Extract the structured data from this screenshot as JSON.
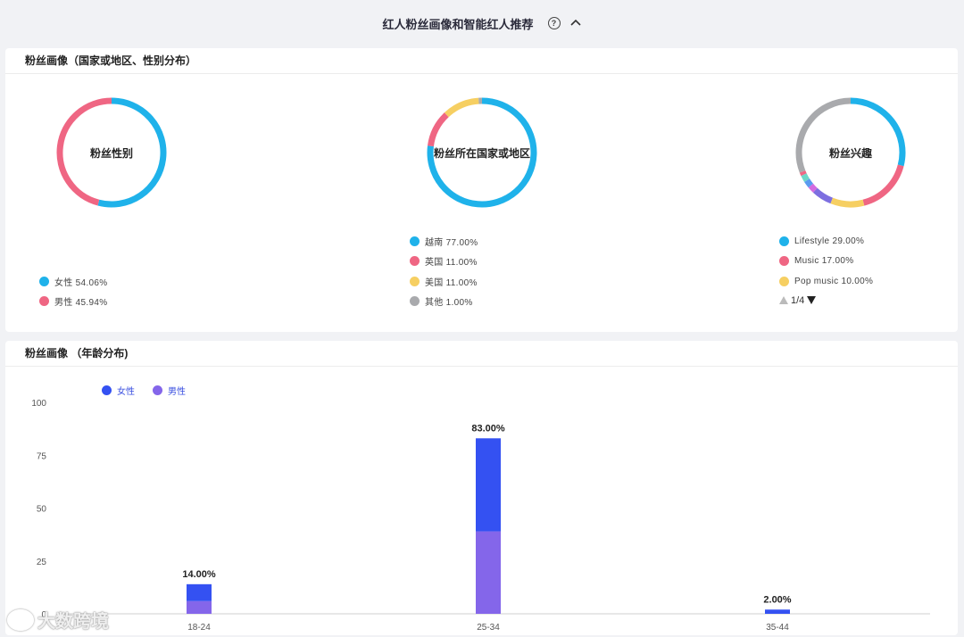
{
  "header": {
    "title": "红人粉丝画像和智能红人推荐",
    "help_glyph": "?",
    "collapse_icon": "chevron-up-icon"
  },
  "profile_card": {
    "title": "粉丝画像（国家或地区、性别分布）",
    "gender": {
      "center_label": "粉丝性别",
      "items": [
        {
          "label": "女性 54.06%",
          "value": 54.06,
          "color": "#1fb2ea"
        },
        {
          "label": "男性 45.94%",
          "value": 45.94,
          "color": "#ef6683"
        }
      ]
    },
    "country": {
      "center_label": "粉丝所在国家或地区",
      "items": [
        {
          "label": "越南 77.00%",
          "value": 77,
          "color": "#1fb2ea"
        },
        {
          "label": "英国 11.00%",
          "value": 11,
          "color": "#ef6683"
        },
        {
          "label": "美国 11.00%",
          "value": 11,
          "color": "#f6cf62"
        },
        {
          "label": "其他 1.00%",
          "value": 1,
          "color": "#a9aaad"
        }
      ]
    },
    "interest": {
      "center_label": "粉丝兴趣",
      "items": [
        {
          "label": "Lifestyle 29.00%",
          "value": 29,
          "color": "#1fb2ea"
        },
        {
          "label": "Music 17.00%",
          "value": 17,
          "color": "#ef6683"
        },
        {
          "label": "Pop music 10.00%",
          "value": 10,
          "color": "#f6cf62"
        }
      ],
      "other_segments": [
        {
          "value": 6,
          "color": "#7d6fe0"
        },
        {
          "value": 2,
          "color": "#d36be0"
        },
        {
          "value": 2,
          "color": "#5a9bf0"
        },
        {
          "value": 2,
          "color": "#6dd7c8"
        },
        {
          "value": 1,
          "color": "#ef6683"
        },
        {
          "value": 31,
          "color": "#a9aaad"
        }
      ],
      "pager": "1/4"
    }
  },
  "age_card": {
    "title": "粉丝画像 （年龄分布)",
    "legend": [
      {
        "label": "女性",
        "color": "#3451f2"
      },
      {
        "label": "男性",
        "color": "#8466ea"
      }
    ]
  },
  "chart_data": {
    "type": "bar",
    "stacked": true,
    "categories": [
      "18-24",
      "25-34",
      "35-44"
    ],
    "series": [
      {
        "name": "男性",
        "values": [
          6,
          39,
          0
        ],
        "color": "#8466ea"
      },
      {
        "name": "女性",
        "values": [
          8,
          44,
          2
        ],
        "color": "#3451f2"
      }
    ],
    "totals": [
      "14.00%",
      "83.00%",
      "2.00%"
    ],
    "yticks": [
      0,
      25,
      50,
      75,
      100
    ],
    "ylim": [
      0,
      100
    ]
  },
  "watermark": "大数跨境"
}
